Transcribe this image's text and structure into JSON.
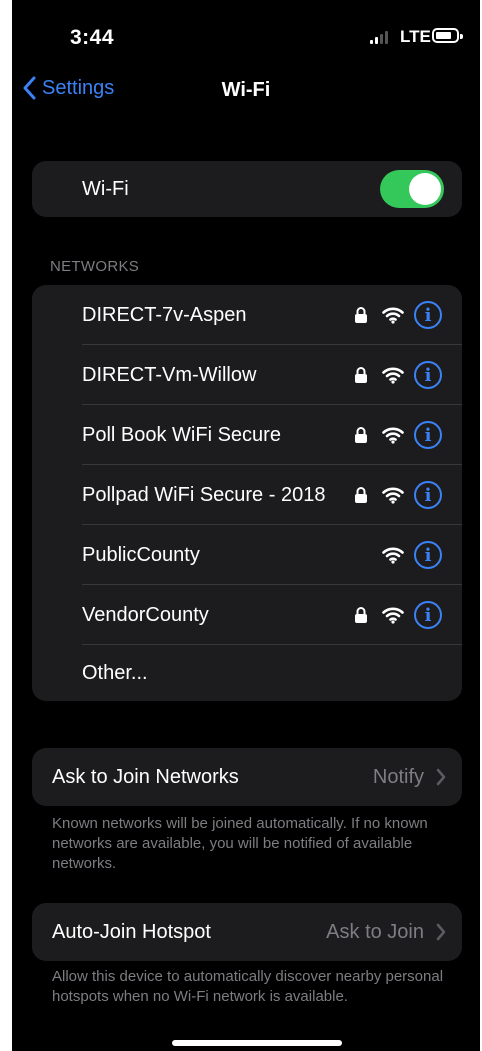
{
  "status_bar": {
    "time": "3:44",
    "network": "LTE"
  },
  "nav": {
    "back_label": "Settings",
    "title": "Wi-Fi"
  },
  "wifi_toggle": {
    "label": "Wi-Fi",
    "on": true
  },
  "networks_header": "NETWORKS",
  "networks": [
    {
      "name": "DIRECT-7v-Aspen",
      "secured": true
    },
    {
      "name": "DIRECT-Vm-Willow",
      "secured": true
    },
    {
      "name": "Poll Book WiFi Secure",
      "secured": true
    },
    {
      "name": "Pollpad WiFi Secure - 2018",
      "secured": true
    },
    {
      "name": "PublicCounty",
      "secured": false
    },
    {
      "name": "VendorCounty",
      "secured": true
    }
  ],
  "other_label": "Other...",
  "ask_to_join": {
    "label": "Ask to Join Networks",
    "value": "Notify",
    "footnote": "Known networks will be joined automatically. If no known networks are available, you will be notified of available networks."
  },
  "auto_join_hotspot": {
    "label": "Auto-Join Hotspot",
    "value": "Ask to Join",
    "footnote": "Allow this device to automatically discover nearby personal hotspots when no Wi-Fi network is available."
  },
  "colors": {
    "accent": "#3b82f6",
    "toggle_on": "#34c759",
    "cell_bg": "#1c1c1e",
    "secondary_text": "#7d7d82"
  },
  "icons": {
    "back": "chevron-left-icon",
    "lock": "lock-icon",
    "wifi": "wifi-icon",
    "info": "info-icon",
    "disclosure": "chevron-right-icon"
  }
}
